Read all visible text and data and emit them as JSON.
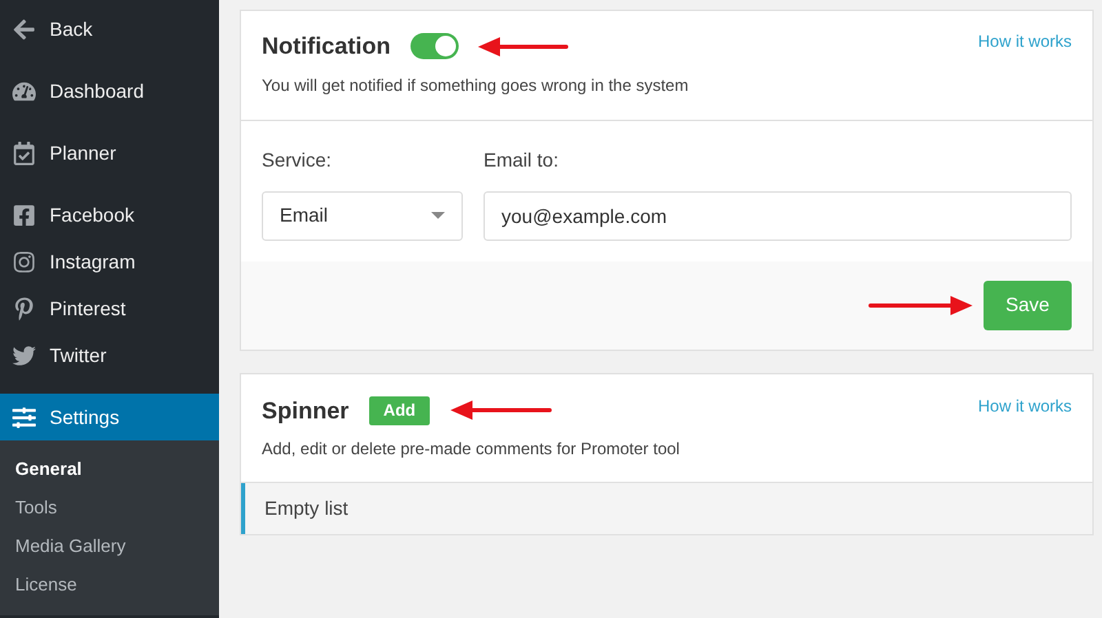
{
  "sidebar": {
    "groups": [
      [
        {
          "label": "Back",
          "selected": false
        }
      ],
      [
        {
          "label": "Dashboard",
          "selected": false
        }
      ],
      [
        {
          "label": "Planner",
          "selected": false
        }
      ],
      [
        {
          "label": "Facebook",
          "selected": false
        },
        {
          "label": "Instagram",
          "selected": false
        },
        {
          "label": "Pinterest",
          "selected": false
        },
        {
          "label": "Twitter",
          "selected": false
        }
      ],
      [
        {
          "label": "Settings",
          "selected": true,
          "children": [
            {
              "label": "General",
              "selected": true
            },
            {
              "label": "Tools",
              "selected": false
            },
            {
              "label": "Media Gallery",
              "selected": false
            },
            {
              "label": "License",
              "selected": false
            }
          ]
        }
      ]
    ]
  },
  "notification": {
    "title": "Notification",
    "on": true,
    "help_link": "How it works",
    "description": "You will get notified if something goes wrong in the system",
    "service_label": "Service:",
    "service_value": "Email",
    "email_label": "Email to:",
    "email_value": "you@example.com",
    "save_button": "Save"
  },
  "spinner": {
    "title": "Spinner",
    "add_button": "Add",
    "help_link": "How it works",
    "description": "Add, edit or delete pre-made comments for Promoter tool",
    "empty_text": "Empty list"
  }
}
